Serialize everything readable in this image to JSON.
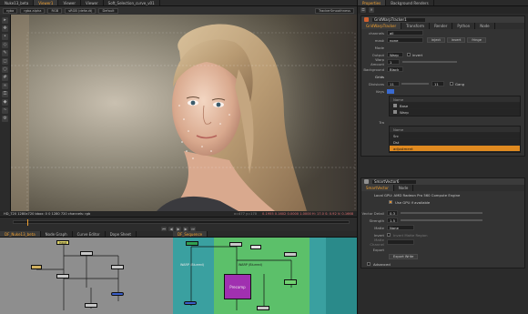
{
  "viewer_tabs": [
    "Nuke13_beta",
    "Viewer1",
    "Viewer",
    "Viewer",
    "Soft_Selection_curve_v01"
  ],
  "viewer_toolbar": [
    "rgba",
    "rgba.alpha",
    "RGB",
    "sRGB (default)",
    "Default",
    "TrackerSmoothness"
  ],
  "viewer_status": "HD_720 1280x720   bbox: 0 0 1280 720   channels: rgb",
  "viewer_status_right": "x=477 y=170",
  "viewer_values": "0.1955  0.1602  0.0000  1.0000  H: 17.0  S: 0.92 V: 0.1668",
  "node_tabs": [
    "DF_Nuke13_beta",
    "Node Graph",
    "Curve Editor",
    "Dope Sheet"
  ],
  "seq_tabs": [
    "DF_Sequence"
  ],
  "properties": {
    "tabs": [
      "Properties",
      "Background Renders"
    ],
    "node_title": "GridWarpTracker1",
    "node_tabs": [
      "GridWarpTracker",
      "Transform",
      "Render",
      "Python",
      "Node"
    ],
    "rows": [
      {
        "label": "channels",
        "value": "all"
      },
      {
        "label": "mask",
        "value": "none"
      },
      {
        "label": "Mode",
        "value": ""
      },
      {
        "label": "Output",
        "value": "Warp"
      },
      {
        "label": "Warp Amount",
        "value": "1"
      },
      {
        "label": "Background",
        "value": "Black"
      },
      {
        "label": "Grids",
        "value": ""
      }
    ],
    "buttons": [
      "inject",
      "invert",
      "fringe"
    ],
    "check_invert": "invert",
    "divisions_label": "Divisions",
    "divisions_value": "11",
    "divisions_value2": "11",
    "gang_label": "Gang",
    "keys_label": "Keys",
    "name_header": "Name",
    "tree1": [
      "Base",
      "Warp"
    ],
    "track_label": "Tra",
    "tree2_header": "Name",
    "tree2": [
      "Src",
      "Dst",
      "adjustment"
    ],
    "ss_title": "SmartVector6",
    "ss_tabs": [
      "SmartVector",
      "Node"
    ],
    "ss_gpu": "Local GPU: AMD Radeon Pro 560 Compute Engine",
    "ss_use_gpu": "Use GPU if available",
    "ss_rows": [
      {
        "label": "Vector Detail",
        "value": "0.3"
      },
      {
        "label": "Strength",
        "value": "1.5"
      },
      {
        "label": "Matte",
        "value": "None"
      },
      {
        "label": "Invert",
        "value": ""
      },
      {
        "label": "Matte Channel",
        "value": ""
      },
      {
        "label": "Export",
        "value": ""
      }
    ],
    "ss_export_btn": "Export Write",
    "ss_invert_check": "Invert Matte Region",
    "ss_advanced": "Advanced"
  },
  "graph_labels": {
    "n1": "Input",
    "n2": "SMDF0",
    "n3": "Postage",
    "n4": "Precomp",
    "b1": "WARP (Blurred)",
    "b2": "WARP (Blurred)"
  }
}
